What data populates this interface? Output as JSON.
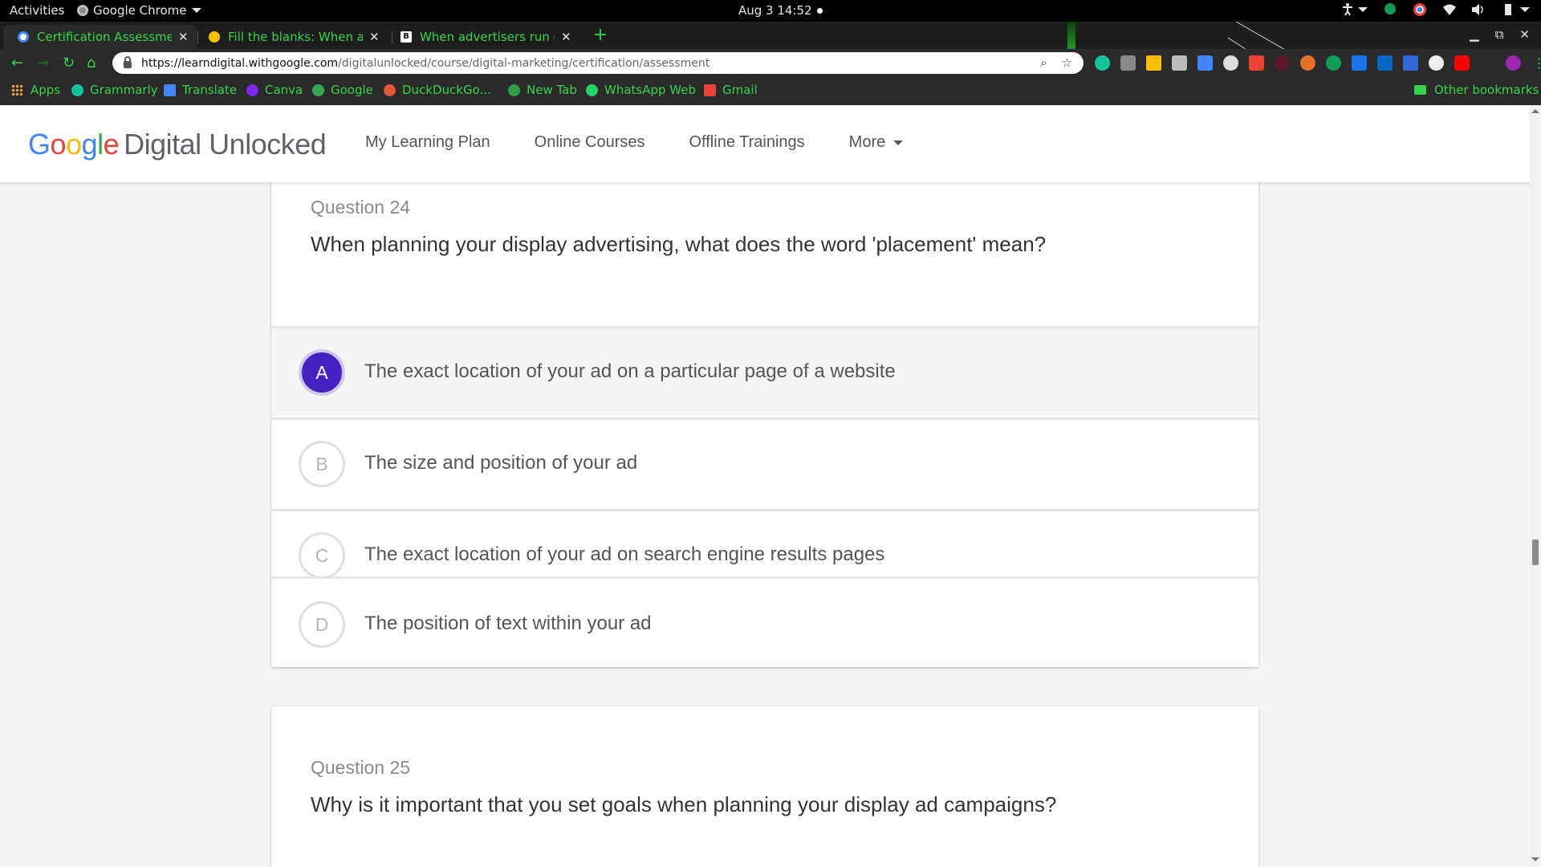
{
  "system": {
    "activities": "Activities",
    "app_name": "Google Chrome",
    "clock": "Aug 3  14:52"
  },
  "tabs": [
    {
      "title": "Certification Assessment",
      "favicon": "google-icon",
      "color": "#4285f4",
      "active": true
    },
    {
      "title": "Fill the blanks: When advertisers",
      "favicon": "quizlet-icon",
      "color": "#f2c200",
      "active": false
    },
    {
      "title": "When advertisers run online",
      "favicon": "brainly-icon",
      "color": "#111111",
      "active": false
    }
  ],
  "address_bar": {
    "host": "https://learndigital.withgoogle.com",
    "path": "/digitalunlocked/course/digital-marketing/certification/assessment"
  },
  "bookmarks": [
    {
      "label": "Apps",
      "icon": "apps-grid-icon",
      "color": "#e8a23b"
    },
    {
      "label": "Grammarly",
      "icon": "grammarly-icon",
      "color": "#15c39a"
    },
    {
      "label": "Translate",
      "icon": "translate-icon",
      "color": "#4285f4"
    },
    {
      "label": "Canva",
      "icon": "canva-icon",
      "color": "#7d2ae8"
    },
    {
      "label": "Google",
      "icon": "google-icon",
      "color": "#34a853"
    },
    {
      "label": "DuckDuckGo...",
      "icon": "duckduckgo-icon",
      "color": "#de5833"
    },
    {
      "label": "New Tab",
      "icon": "newtab-icon",
      "color": "#2e9e44"
    },
    {
      "label": "WhatsApp Web",
      "icon": "whatsapp-icon",
      "color": "#25d366"
    },
    {
      "label": "Gmail",
      "icon": "gmail-icon",
      "color": "#ea4335"
    },
    {
      "label": "Other bookmarks",
      "icon": "folder-icon",
      "color": "#33d44a"
    }
  ],
  "site": {
    "logo_google": [
      "G",
      "o",
      "o",
      "g",
      "l",
      "e"
    ],
    "logo_suffix": "Digital Unlocked",
    "nav": [
      "My Learning Plan",
      "Online Courses",
      "Offline Trainings",
      "More"
    ]
  },
  "questions": [
    {
      "label": "Question 24",
      "text": "When planning your display advertising, what does the word 'placement' mean?",
      "selected": "A",
      "options": [
        {
          "letter": "A",
          "text": "The exact location of your ad on a particular page of a website"
        },
        {
          "letter": "B",
          "text": "The size and position of your ad"
        },
        {
          "letter": "C",
          "text": "The exact location of your ad on search engine results pages"
        },
        {
          "letter": "D",
          "text": "The position of text within your ad"
        }
      ]
    },
    {
      "label": "Question 25",
      "text": "Why is it important that you set goals when planning your display ad campaigns?"
    }
  ],
  "colors": {
    "accent_selected": "#4521c2",
    "browser_theme_text": "#33d44a"
  }
}
